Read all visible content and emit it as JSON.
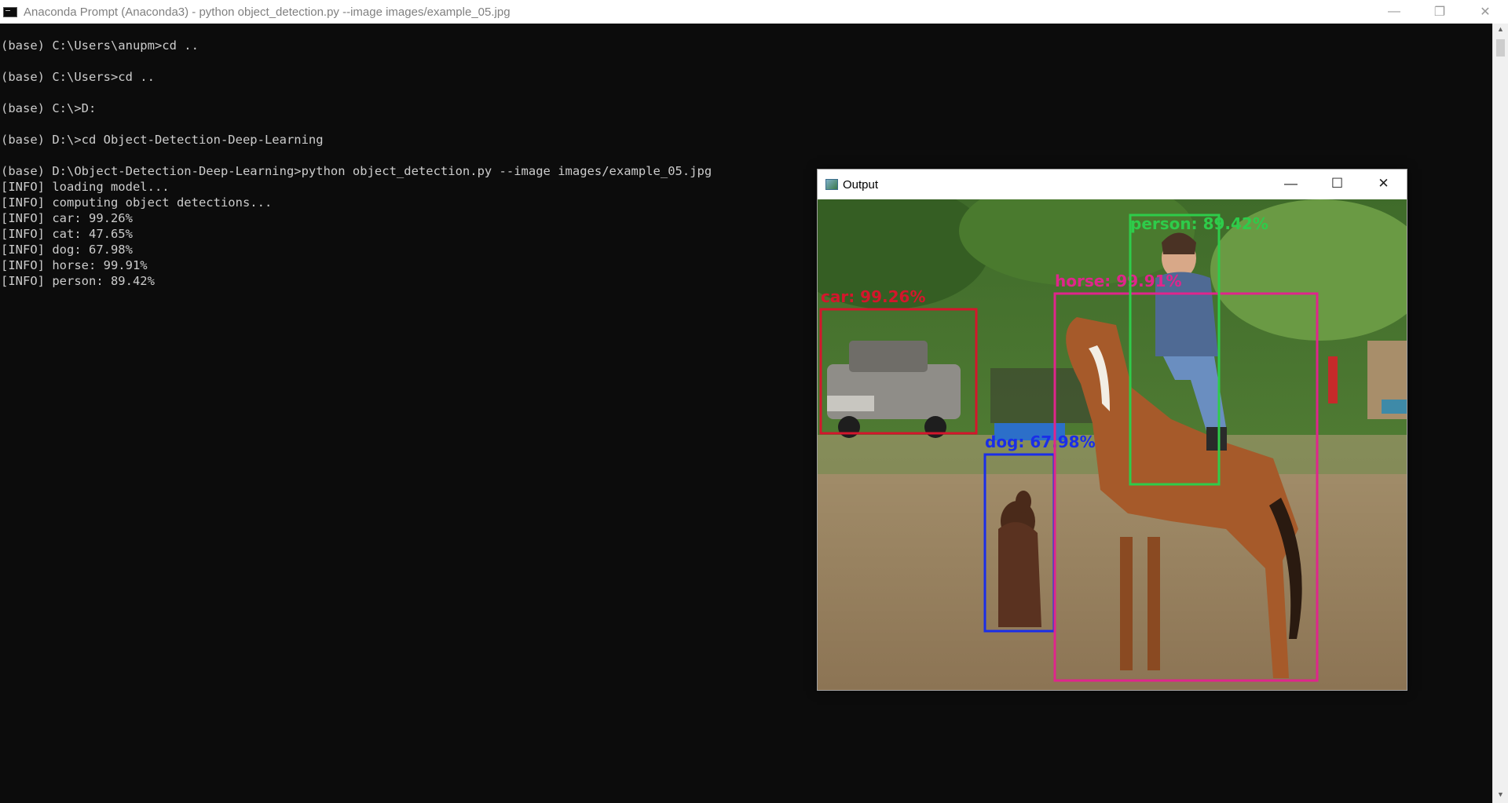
{
  "window": {
    "title": "Anaconda Prompt (Anaconda3) - python  object_detection.py --image images/example_05.jpg",
    "min_label": "—",
    "restore_label": "❐",
    "close_label": "✕"
  },
  "console": {
    "lines": [
      "(base) C:\\Users\\anupm>cd ..",
      "",
      "(base) C:\\Users>cd ..",
      "",
      "(base) C:\\>D:",
      "",
      "(base) D:\\>cd Object-Detection-Deep-Learning",
      "",
      "(base) D:\\Object-Detection-Deep-Learning>python object_detection.py --image images/example_05.jpg",
      "[INFO] loading model...",
      "[INFO] computing object detections...",
      "[INFO] car: 99.26%",
      "[INFO] cat: 47.65%",
      "[INFO] dog: 67.98%",
      "[INFO] horse: 99.91%",
      "[INFO] person: 89.42%"
    ]
  },
  "scrollbar": {
    "up_arrow": "▲",
    "down_arrow": "▼"
  },
  "output_window": {
    "title": "Output",
    "min_label": "—",
    "max_label": "☐",
    "close_label": "✕",
    "detections": [
      {
        "label": "car: 99.26%",
        "color": "#d4162c"
      },
      {
        "label": "dog: 67.98%",
        "color": "#1a2ee8"
      },
      {
        "label": "horse: 99.91%",
        "color": "#e0258c"
      },
      {
        "label": "person: 89.42%",
        "color": "#2ecc4a"
      }
    ]
  }
}
